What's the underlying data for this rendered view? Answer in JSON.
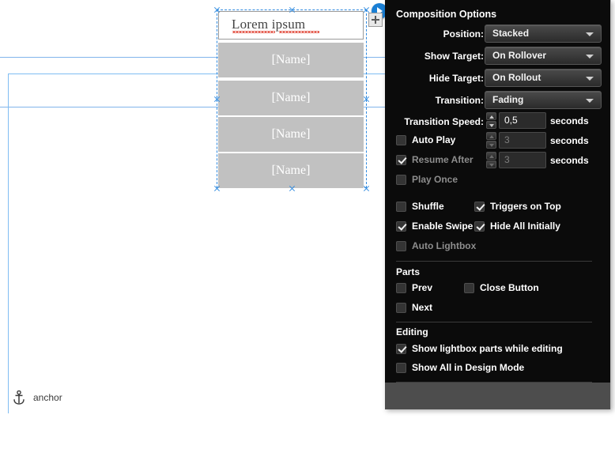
{
  "canvas": {
    "textbox": {
      "text": "Lorem ipsum"
    },
    "name_boxes": [
      {
        "label": "[Name]"
      },
      {
        "label": "[Name]"
      },
      {
        "label": "[Name]"
      },
      {
        "label": "[Name]"
      }
    ],
    "anchor": {
      "label": "anchor",
      "icon": "anchor-icon"
    },
    "widget_buttons": [
      {
        "icon": "play-icon",
        "color": "#1a7fd4"
      },
      {
        "icon": "plus-icon",
        "color": "#e8e8e8"
      }
    ],
    "selection_color": "#2f8ae0",
    "guide_color": "#6ba7e8",
    "box_fill": "#c1c1c1"
  },
  "panel": {
    "title": "Composition Options",
    "fields": [
      {
        "label": "Position:",
        "value": "Stacked"
      },
      {
        "label": "Show Target:",
        "value": "On Rollover"
      },
      {
        "label": "Hide Target:",
        "value": "On Rollout"
      },
      {
        "label": "Transition:",
        "value": "Fading"
      }
    ],
    "speed_rows": [
      {
        "label": "Transition Speed:",
        "value": "0,5",
        "units": "seconds",
        "kind": "label",
        "enabled": true,
        "checked": false
      },
      {
        "label": "Auto Play",
        "value": "3",
        "units": "seconds",
        "kind": "checkbox",
        "enabled": false,
        "checked": false
      },
      {
        "label": "Resume After",
        "value": "3",
        "units": "seconds",
        "kind": "checkbox",
        "enabled": false,
        "checked": true
      },
      {
        "label": "Play Once",
        "value": "",
        "units": "",
        "kind": "checkbox",
        "enabled": false,
        "checked": false
      }
    ],
    "toggles": [
      {
        "label": "Shuffle",
        "checked": false,
        "enabled": true
      },
      {
        "label": "Triggers on Top",
        "checked": true,
        "enabled": true
      },
      {
        "label": "Enable Swipe",
        "checked": true,
        "enabled": true
      },
      {
        "label": "Hide All Initially",
        "checked": true,
        "enabled": true
      },
      {
        "label": "Auto Lightbox",
        "checked": false,
        "enabled": false
      }
    ],
    "parts": {
      "title": "Parts",
      "items": [
        {
          "label": "Prev",
          "checked": false
        },
        {
          "label": "Close Button",
          "checked": false
        },
        {
          "label": "Next",
          "checked": false
        }
      ]
    },
    "editing": {
      "title": "Editing",
      "items": [
        {
          "label": "Show lightbox parts while editing",
          "checked": true
        },
        {
          "label": "Show All in Design Mode",
          "checked": false
        }
      ]
    },
    "help": {
      "icon": "help-icon"
    },
    "background": "#0b0b0b",
    "footer_color": "#4d4d4d"
  }
}
